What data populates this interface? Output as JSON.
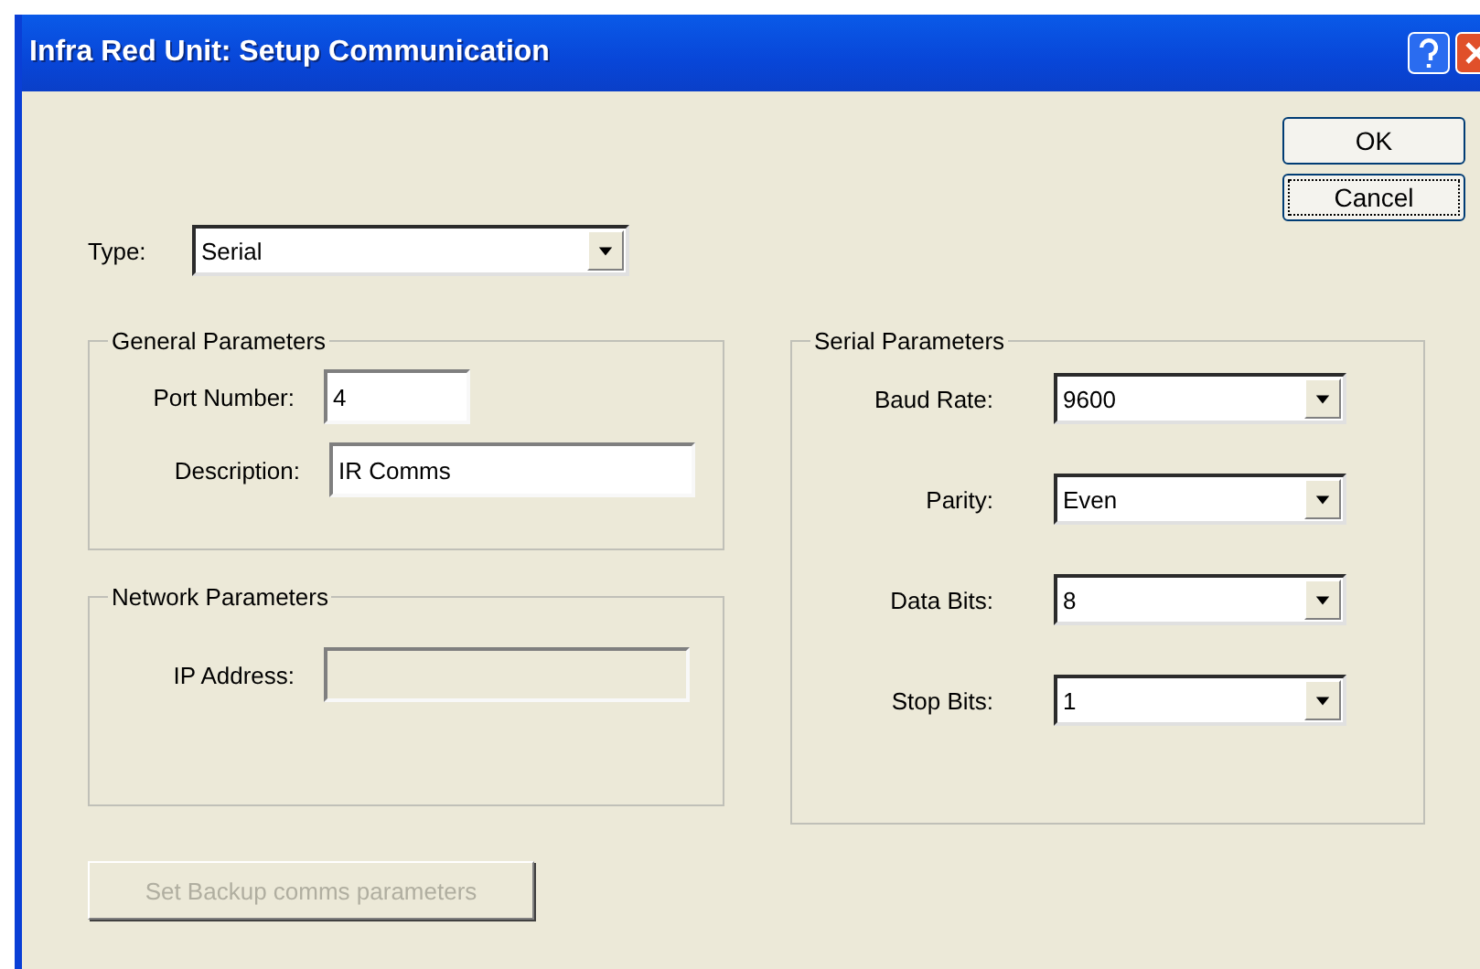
{
  "window": {
    "title": "Infra Red Unit: Setup Communication"
  },
  "type_field": {
    "label": "Type:",
    "value": "Serial"
  },
  "buttons": [
    {
      "label": "OK",
      "focused": false
    },
    {
      "label": "Cancel",
      "focused": true
    }
  ],
  "general_parameters": {
    "title": "General Parameters",
    "fields": [
      {
        "label": "Port Number:",
        "value": "4",
        "wide": false
      },
      {
        "label": "Description:",
        "value": "IR Comms",
        "wide": true
      }
    ]
  },
  "network_parameters": {
    "title": "Network Parameters",
    "fields": [
      {
        "label": "IP Address:",
        "disabled": true
      }
    ]
  },
  "backup_button": {
    "label": "Set Backup comms parameters",
    "disabled": true
  },
  "serial_parameters": {
    "title": "Serial Parameters",
    "fields": [
      {
        "label": "Baud Rate:",
        "value": "9600"
      },
      {
        "label": "Parity:",
        "value": "Even"
      },
      {
        "label": "Data Bits:",
        "value": "8"
      },
      {
        "label": "Stop Bits:",
        "value": "1"
      }
    ]
  }
}
